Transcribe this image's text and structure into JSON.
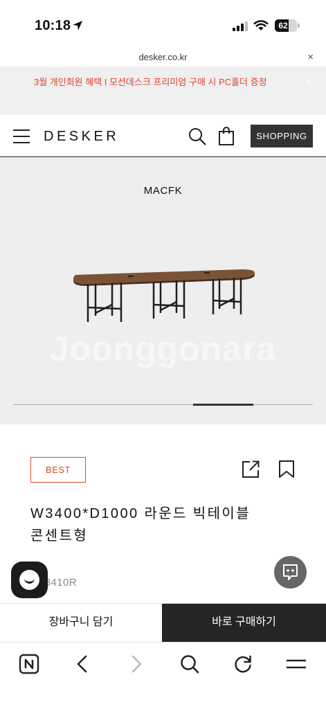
{
  "status_bar": {
    "time": "10:18",
    "battery": "62",
    "battery_level": 0.62
  },
  "url_bar": {
    "domain": "desker.co.kr",
    "close_glyph": "×"
  },
  "promo_banner": {
    "text": "3월 개인회원 혜택 I 모션데스크 프리미엄 구매 시 PC홀더 증정",
    "close_glyph": "×"
  },
  "header": {
    "logo": "DESKER",
    "shopping_label": "SHOPPING"
  },
  "gallery": {
    "caption": "MACFK",
    "watermark": "Joonggonara",
    "slide_position": 0.75
  },
  "product": {
    "badge": "BEST",
    "title": "W3400*D1000 라운드 빅테이블 콘센트형",
    "code": "TC3410R"
  },
  "actions": {
    "cart_label": "장바구니 담기",
    "buy_label": "바로 구매하기"
  },
  "browser_toolbar": {
    "icons": [
      "naver-home-icon",
      "back-icon",
      "forward-icon",
      "search-icon",
      "reload-icon",
      "menu-icon"
    ]
  },
  "colors": {
    "accent_red": "#e0452d",
    "dark": "#252525",
    "gallery_bg": "#eeeeee"
  }
}
